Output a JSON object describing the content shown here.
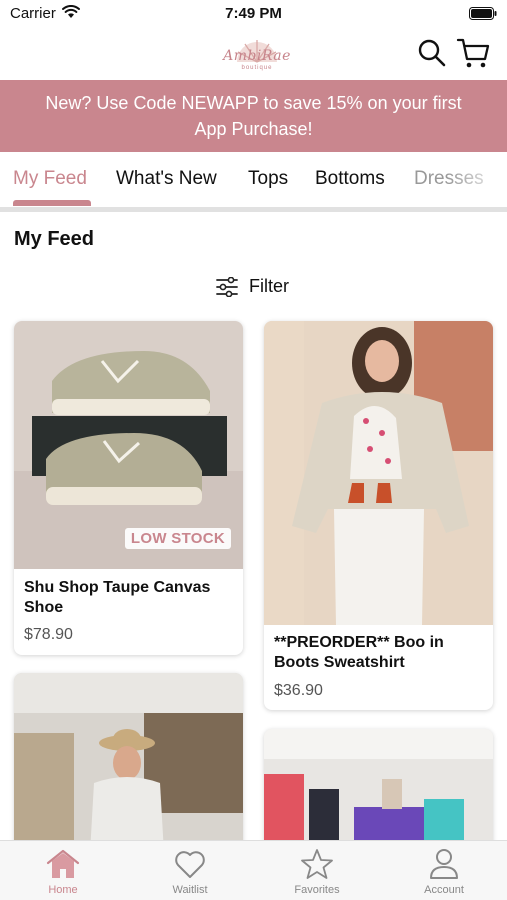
{
  "status_bar": {
    "carrier": "Carrier",
    "time": "7:49 PM"
  },
  "header": {
    "logo_text": "AmbiRae",
    "logo_sub": "boutique"
  },
  "promo": {
    "line1": "New? Use Code NEWAPP to save 15% on your first",
    "line2": "App Purchase!"
  },
  "tabs": [
    "My Feed",
    "What's New",
    "Tops",
    "Bottoms",
    "Dresses"
  ],
  "page_title": "My Feed",
  "filter_label": "Filter",
  "products": [
    {
      "title": "Shu Shop Taupe Canvas Shoe",
      "price": "$78.90",
      "badge": "LOW STOCK"
    },
    {
      "title": "**PREORDER** Boo in Boots Sweatshirt",
      "price": "$36.90"
    }
  ],
  "nav": {
    "home": "Home",
    "waitlist": "Waitlist",
    "favorites": "Favorites",
    "account": "Account"
  },
  "colors": {
    "accent": "#c9868e",
    "banner": "#c9868e",
    "tab_divider": "#e1e1e1"
  },
  "icons": [
    "wifi-icon",
    "battery-icon",
    "search-icon",
    "cart-icon",
    "filter-icon",
    "home-icon",
    "heart-icon",
    "star-icon",
    "person-icon"
  ]
}
